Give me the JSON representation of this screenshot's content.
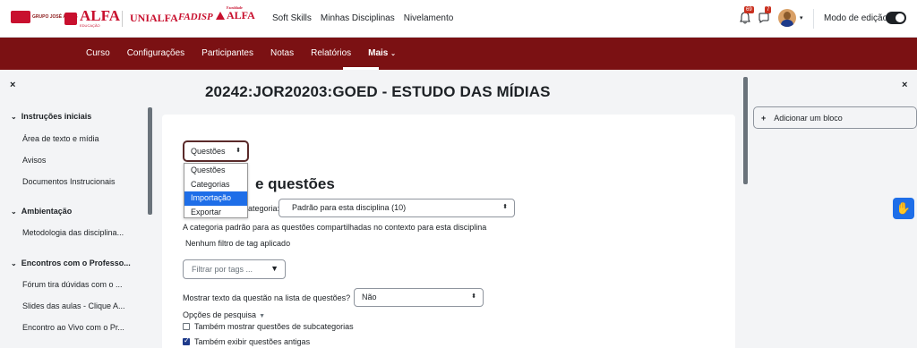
{
  "header": {
    "logos": {
      "grupo": "GRUPO JOSÉ ALVES",
      "alfa": "ALFA",
      "alfa_sub": "EDUCAÇÃO",
      "unialfa": "UNIALFA",
      "fadisp": "FADISP",
      "alfa2_pre": "Faculdade",
      "alfa2": "ALFA"
    },
    "nav": [
      "Soft Skills",
      "Minhas Disciplinas",
      "Nivelamento"
    ],
    "notifications_count": "69",
    "messages_count": "7",
    "edit_mode_label": "Modo de edição",
    "edit_mode_on": true
  },
  "secondary_nav": {
    "items": [
      "Curso",
      "Configurações",
      "Participantes",
      "Notas",
      "Relatórios",
      "Mais"
    ],
    "active": "Mais"
  },
  "left_drawer": {
    "close_icon": "×",
    "sections": [
      {
        "title": "Instruções iniciais",
        "items": [
          "Área de texto e mídia",
          "Avisos",
          "Documentos Instrucionais"
        ]
      },
      {
        "title": "Ambientação",
        "items": [
          "Metodologia das disciplina..."
        ]
      },
      {
        "title": "Encontros com o Professo...",
        "items": [
          "Fórum tira dúvidas com o ...",
          "Slides das aulas - Clique A...",
          "Encontro ao Vivo com o Pr..."
        ]
      }
    ]
  },
  "main": {
    "page_title": "20242:JOR20203:GOED - ESTUDO DAS MÍDIAS",
    "nav_select": {
      "value": "Questões",
      "options": [
        "Questões",
        "Categorias",
        "Importação",
        "Exportar"
      ],
      "highlighted": "Importação"
    },
    "heading_partial": "e questões",
    "category_label_partial": "ategoria:",
    "category_select": "Padrão para esta disciplina (10)",
    "category_desc": "A categoria padrão para as questões compartilhadas no contexto para esta disciplina",
    "no_tag_filter": "Nenhum filtro de tag aplicado",
    "tag_filter_placeholder": "Filtrar por tags ...",
    "show_text_label": "Mostrar texto da questão na lista de questões?",
    "show_text_value": "Não",
    "search_options_label": "Opções de pesquisa",
    "checkboxes": [
      {
        "label": "Também mostrar questões de subcategorias",
        "checked": false
      },
      {
        "label": "Também exibir questões antigas",
        "checked": true
      }
    ]
  },
  "right_drawer": {
    "close_icon": "×",
    "add_block_label": "Adicionar um bloco"
  },
  "colors": {
    "brand_red": "#c8102e",
    "secondary_nav_bg": "#7b1113",
    "highlight_blue": "#1e6ee8"
  }
}
